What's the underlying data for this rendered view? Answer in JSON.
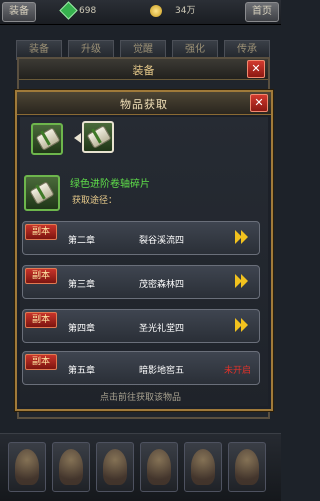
{
  "topbar": {
    "back_label": "装备",
    "gems": "698",
    "gold": "34万",
    "home_label": "首页"
  },
  "bg_tabs": [
    "装备",
    "升级",
    "觉醒",
    "强化",
    "传承"
  ],
  "equip_dialog": {
    "title": "装备"
  },
  "acquire_dialog": {
    "title": "物品获取",
    "item_name": "绿色进阶卷轴碎片",
    "acquire_way_label": "获取途径：",
    "routes": [
      {
        "tag": "副本",
        "chapter": "第二章",
        "stage": "裂谷溪流四",
        "status": "go"
      },
      {
        "tag": "副本",
        "chapter": "第三章",
        "stage": "茂密森林四",
        "status": "go"
      },
      {
        "tag": "副本",
        "chapter": "第四章",
        "stage": "圣光礼堂四",
        "status": "go"
      },
      {
        "tag": "副本",
        "chapter": "第五章",
        "stage": "暗影地窖五",
        "status": "locked",
        "status_text": "未开启"
      }
    ],
    "hint": "点击前往获取该物品",
    "close_icon": "close-icon"
  },
  "colors": {
    "item_green": "#5fe04a",
    "arrow_yellow": "#f2c21e",
    "locked_red": "#e0322a",
    "tag_red": "#c8342a"
  }
}
